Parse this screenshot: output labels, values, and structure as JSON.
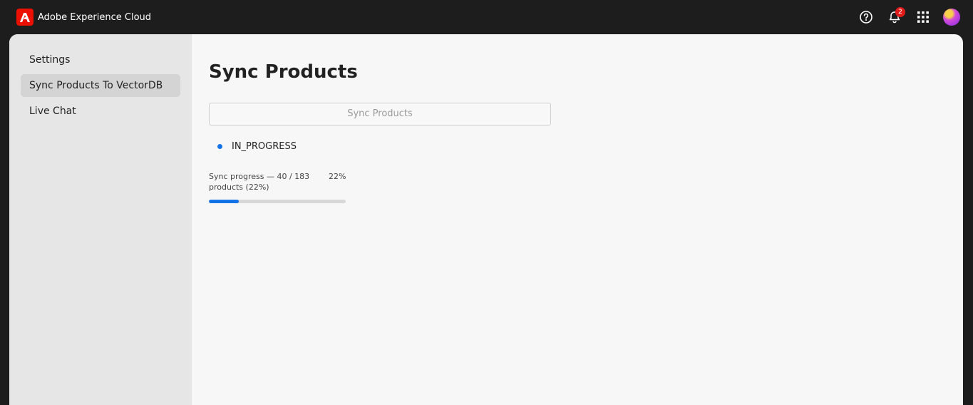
{
  "header": {
    "brand": "Adobe Experience Cloud",
    "notifications_count": "2",
    "icons": [
      "adobe-logo-icon",
      "help-icon",
      "bell-icon",
      "apps-grid-icon",
      "avatar"
    ]
  },
  "sidebar": {
    "items": [
      {
        "label": "Settings",
        "active": false
      },
      {
        "label": "Sync Products To VectorDB",
        "active": true
      },
      {
        "label": "Live Chat",
        "active": false
      }
    ]
  },
  "main": {
    "title": "Sync Products",
    "sync_button_label": "Sync Products",
    "status": "IN_PROGRESS",
    "progress": {
      "label": "Sync progress — 40 / 183 products (22%)",
      "percent_text": "22%",
      "value": 0.22
    }
  },
  "colors": {
    "accent": "#1473e6",
    "adobe_red": "#eb1000",
    "topbar": "#1d1d1d",
    "badge": "#e11a1a"
  }
}
